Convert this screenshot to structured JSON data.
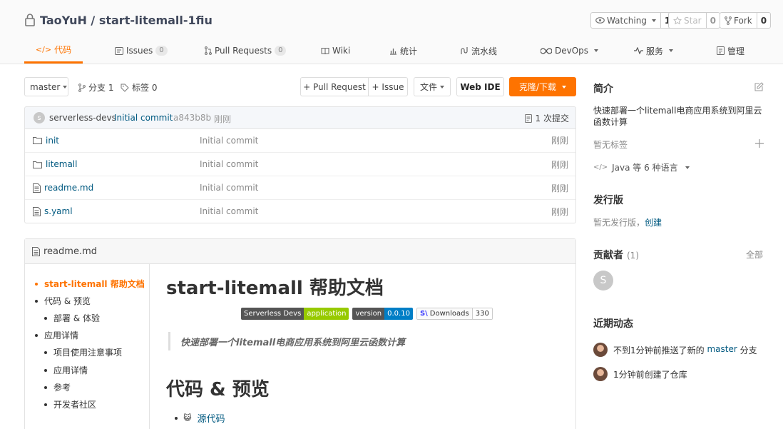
{
  "repo": {
    "owner": "TaoYuH",
    "separator": " / ",
    "name": "start-litemall-1fiu"
  },
  "social": {
    "watch_label": "Watching",
    "watch_count": "1",
    "star_label": "Star",
    "star_count": "0",
    "fork_label": "Fork",
    "fork_count": "0"
  },
  "tabs": [
    {
      "label": "代码"
    },
    {
      "label": "Issues",
      "badge": "0"
    },
    {
      "label": "Pull Requests",
      "badge": "0"
    },
    {
      "label": "Wiki"
    },
    {
      "label": "统计"
    },
    {
      "label": "流水线"
    },
    {
      "label": "DevOps"
    },
    {
      "label": "服务"
    },
    {
      "label": "管理"
    }
  ],
  "toolbar": {
    "branch": "master",
    "branches": "分支 1",
    "tags": "标签 0",
    "pull_request": "+ Pull Request",
    "issue": "+ Issue",
    "file": "文件",
    "web_ide": "Web IDE",
    "clone": "克隆/下载"
  },
  "commit": {
    "avatar_letter": "s",
    "author": "serverless-devs",
    "message": "Initial commit",
    "sha": "a843b8b",
    "time": "刚刚",
    "count": "1 次提交"
  },
  "files": [
    {
      "name": "init",
      "type": "folder",
      "message": "Initial commit",
      "time": "刚刚"
    },
    {
      "name": "litemall",
      "type": "folder",
      "message": "Initial commit",
      "time": "刚刚"
    },
    {
      "name": "readme.md",
      "type": "file",
      "message": "Initial commit",
      "time": "刚刚"
    },
    {
      "name": "s.yaml",
      "type": "file",
      "message": "Initial commit",
      "time": "刚刚"
    }
  ],
  "readme": {
    "filename": "readme.md",
    "toc": [
      {
        "label": "start-litemall 帮助文档",
        "level": 0,
        "active": true
      },
      {
        "label": "代码 & 预览",
        "level": 0
      },
      {
        "label": "部署 & 体验",
        "level": 1
      },
      {
        "label": "应用详情",
        "level": 0
      },
      {
        "label": "项目使用注意事项",
        "level": 1
      },
      {
        "label": "应用详情",
        "level": 1
      },
      {
        "label": "参考",
        "level": 1
      },
      {
        "label": "开发者社区",
        "level": 1
      }
    ],
    "h1": "start-litemall 帮助文档",
    "badges": {
      "b1_left": "Serverless Devs",
      "b1_right": "application",
      "b2_left": "version",
      "b2_right": "0.0.10",
      "b3_left": "Downloads",
      "b3_right": "330"
    },
    "quote": "快速部署一个litemall电商应用系统到阿里云函数计算",
    "h2": "代码 & 预览",
    "source_link": "源代码"
  },
  "sidebar": {
    "intro_title": "简介",
    "description": "快速部署一个litemall电商应用系统到阿里云函数计算",
    "no_tags": "暂无标签",
    "languages": "Java 等 6 种语言",
    "release_title": "发行版",
    "no_release": "暂无发行版，",
    "create": "创建",
    "contributors_title": "贡献者",
    "contributors_count": "(1)",
    "all": "全部",
    "contributor_letter": "S",
    "activity_title": "近期动态",
    "activity1_pre": "不到1分钟前推送了新的 ",
    "activity1_branch": "master",
    "activity1_post": " 分支",
    "activity2": "1分钟前创建了仓库"
  },
  "colors": {
    "accent": "#fe7300",
    "link": "#005980"
  }
}
